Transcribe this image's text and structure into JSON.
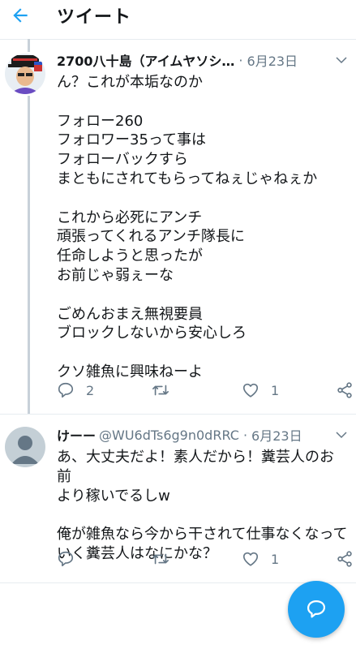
{
  "header": {
    "title": "ツイート"
  },
  "tweets": [
    {
      "name": "2700八十島（アイムヤソシ…",
      "handle": "",
      "date": "6月23日",
      "text": "ん？これが本垢なのか\n\nフォロー260\nフォロワー35って事は\nフォローバックすら\nまともにされてもらってねぇじゃねぇか\n\nこれから必死にアンチ\n頑張ってくれるアンチ隊長に\n任命しようと思ったが\nお前じゃ弱ぇーな\n\nごめんおまえ無視要員\nブロックしないから安心しろ\n\nクソ雑魚に興味ねーよ",
      "replies": "2",
      "retweets": "",
      "likes": "1"
    },
    {
      "name": "けーー",
      "handle": "@WU6dTs6g9n0dRRC",
      "date": "6月23日",
      "text": "あ、大丈夫だよ！素人だから！糞芸人のお前\nより稼いでるしw\n\n俺が雑魚なら今から干されて仕事なくなって\nいく糞芸人はなにかな？",
      "replies": "",
      "retweets": "",
      "likes": "1"
    }
  ],
  "icons": {
    "back": "back-arrow-icon",
    "caret": "chevron-down-icon",
    "reply": "reply-icon",
    "retweet": "retweet-icon",
    "like": "heart-icon",
    "share": "share-icon",
    "compose": "compose-icon"
  },
  "colors": {
    "accent": "#1da1f2",
    "text": "#14171a",
    "secondary": "#657786",
    "border": "#e6ecf0"
  }
}
